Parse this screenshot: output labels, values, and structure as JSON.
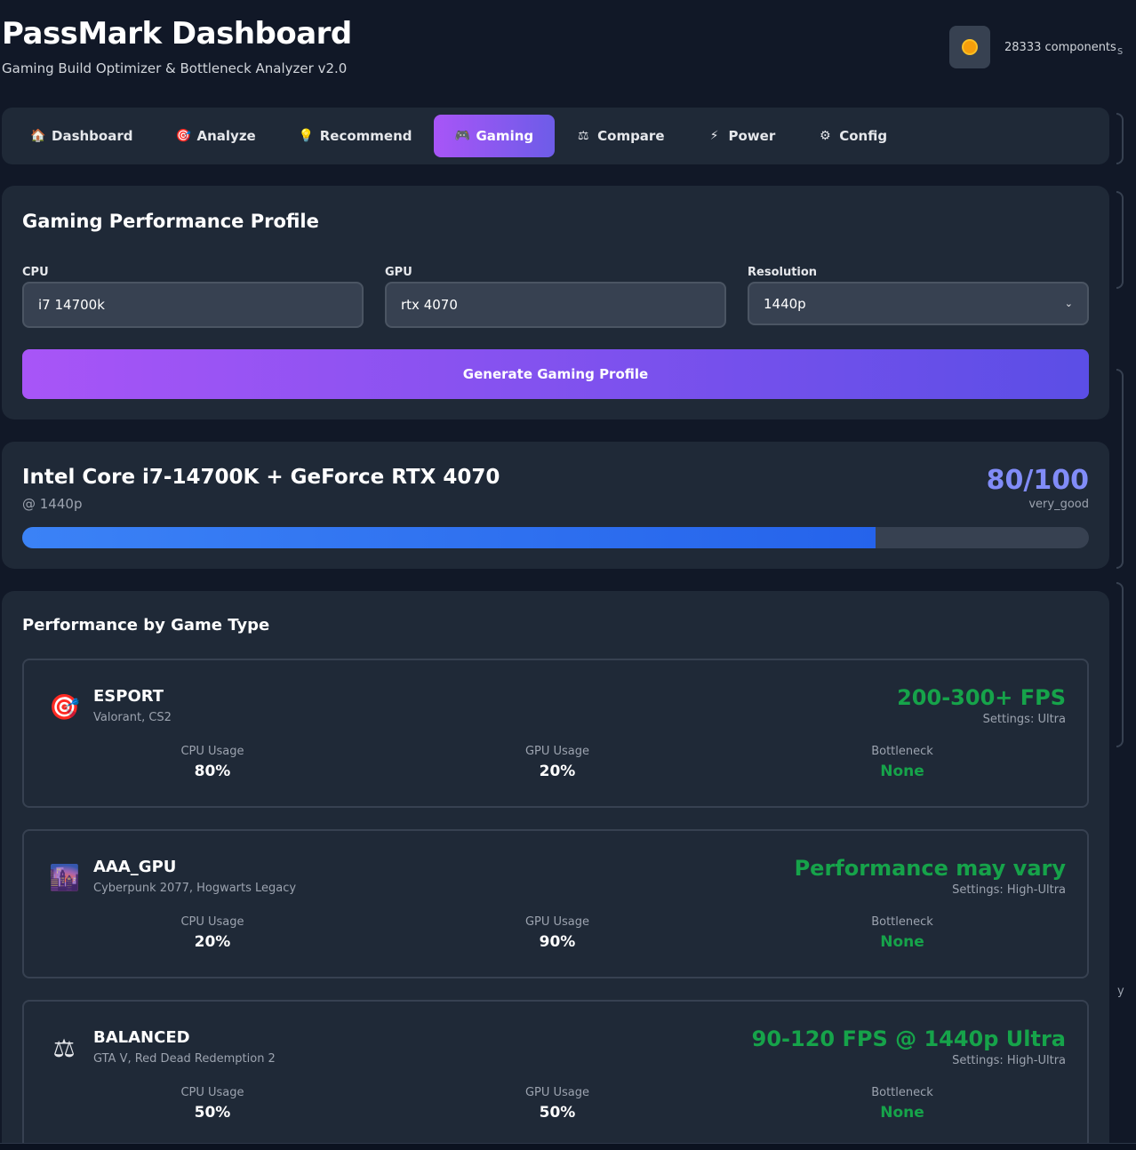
{
  "header": {
    "title": "PassMark Dashboard",
    "subtitle": "Gaming Build Optimizer & Bottleneck Analyzer v2.0",
    "components_count": "28333 components",
    "edge_text": "s"
  },
  "tabs": [
    {
      "label": "Dashboard",
      "icon": "🏠"
    },
    {
      "label": "Analyze",
      "icon": "🎯"
    },
    {
      "label": "Recommend",
      "icon": "💡"
    },
    {
      "label": "Gaming",
      "icon": "🎮",
      "active": true
    },
    {
      "label": "Compare",
      "icon": "⚖"
    },
    {
      "label": "Power",
      "icon": "⚡"
    },
    {
      "label": "Config",
      "icon": "⚙"
    }
  ],
  "profile_form": {
    "title": "Gaming Performance Profile",
    "cpu_label": "CPU",
    "cpu_value": "i7 14700k",
    "gpu_label": "GPU",
    "gpu_value": "rtx 4070",
    "resolution_label": "Resolution",
    "resolution_value": "1440p",
    "generate_label": "Generate Gaming Profile"
  },
  "result": {
    "build_name": "Intel Core i7-14700K + GeForce RTX 4070",
    "resolution": "@ 1440p",
    "score": "80/100",
    "score_fraction": 0.8,
    "rating": "very_good"
  },
  "games": {
    "title": "Performance by Game Type",
    "items": [
      {
        "icon": "🎯",
        "icon_name": "target-icon",
        "name": "ESPORT",
        "titles": "Valorant, CS2",
        "fps": "200-300+ FPS",
        "settings": "Settings: Ultra",
        "cpu_label": "CPU Usage",
        "cpu": "80%",
        "gpu_label": "GPU Usage",
        "gpu": "20%",
        "bottleneck_label": "Bottleneck",
        "bottleneck": "None"
      },
      {
        "icon": "🌆",
        "icon_name": "city-icon",
        "name": "AAA_GPU",
        "titles": "Cyberpunk 2077, Hogwarts Legacy",
        "fps": "Performance may vary",
        "settings": "Settings: High-Ultra",
        "cpu_label": "CPU Usage",
        "cpu": "20%",
        "gpu_label": "GPU Usage",
        "gpu": "90%",
        "bottleneck_label": "Bottleneck",
        "bottleneck": "None"
      },
      {
        "icon": "⚖",
        "icon_name": "scales-icon",
        "name": "BALANCED",
        "titles": "GTA V, Red Dead Redemption 2",
        "fps": "90-120 FPS @ 1440p Ultra",
        "settings": "Settings: High-Ultra",
        "cpu_label": "CPU Usage",
        "cpu": "50%",
        "gpu_label": "GPU Usage",
        "gpu": "50%",
        "bottleneck_label": "Bottleneck",
        "bottleneck": "None"
      }
    ]
  },
  "edge_text_right": "y",
  "colors": {
    "accent_purple": "#a855f7",
    "accent_indigo": "#6366f1",
    "score": "#818cf8",
    "success": "#16a34a",
    "bar": "#3b82f6"
  }
}
